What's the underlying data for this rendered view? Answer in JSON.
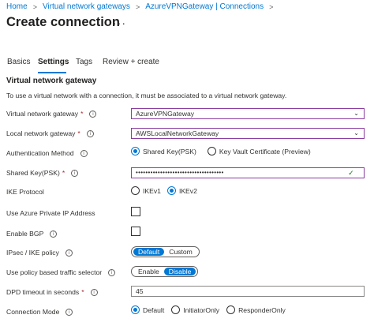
{
  "breadcrumb": {
    "items": [
      "Home",
      "Virtual network gateways",
      "AzureVPNGateway | Connections"
    ]
  },
  "page": {
    "title": "Create connection",
    "more": "···"
  },
  "tabs": [
    "Basics",
    "Settings",
    "Tags",
    "Review + create"
  ],
  "section": {
    "title": "Virtual network gateway",
    "description": "To use a virtual network with a connection, it must be associated to a virtual network gateway."
  },
  "fields": {
    "vng": {
      "label": "Virtual network gateway",
      "required": "*",
      "value": "AzureVPNGateway"
    },
    "lng": {
      "label": "Local network gateway",
      "required": "*",
      "value": "AWSLocalNetworkGateway"
    },
    "auth": {
      "label": "Authentication Method",
      "options": [
        "Shared Key(PSK)",
        "Key Vault Certificate (Preview)"
      ],
      "selected": "Shared Key(PSK)"
    },
    "psk": {
      "label": "Shared Key(PSK)",
      "required": "*",
      "value": "••••••••••••••••••••••••••••••••••••"
    },
    "ike": {
      "label": "IKE Protocol",
      "options": [
        "IKEv1",
        "IKEv2"
      ],
      "selected": "IKEv2"
    },
    "private_ip": {
      "label": "Use Azure Private IP Address",
      "checked": false
    },
    "bgp": {
      "label": "Enable BGP",
      "checked": false
    },
    "ipsec": {
      "label": "IPsec / IKE policy",
      "options": [
        "Default",
        "Custom"
      ],
      "selected": "Default"
    },
    "policy_selector": {
      "label": "Use policy based traffic selector",
      "options": [
        "Enable",
        "Disable"
      ],
      "selected": "Disable"
    },
    "dpd": {
      "label": "DPD timeout in seconds",
      "required": "*",
      "value": "45"
    },
    "mode": {
      "label": "Connection Mode",
      "options": [
        "Default",
        "InitiatorOnly",
        "ResponderOnly"
      ],
      "selected": "Default"
    }
  },
  "colors": {
    "accent": "#0078d4",
    "focus_border": "#8a3da0",
    "required": "#a4262c",
    "valid": "#107c10"
  }
}
